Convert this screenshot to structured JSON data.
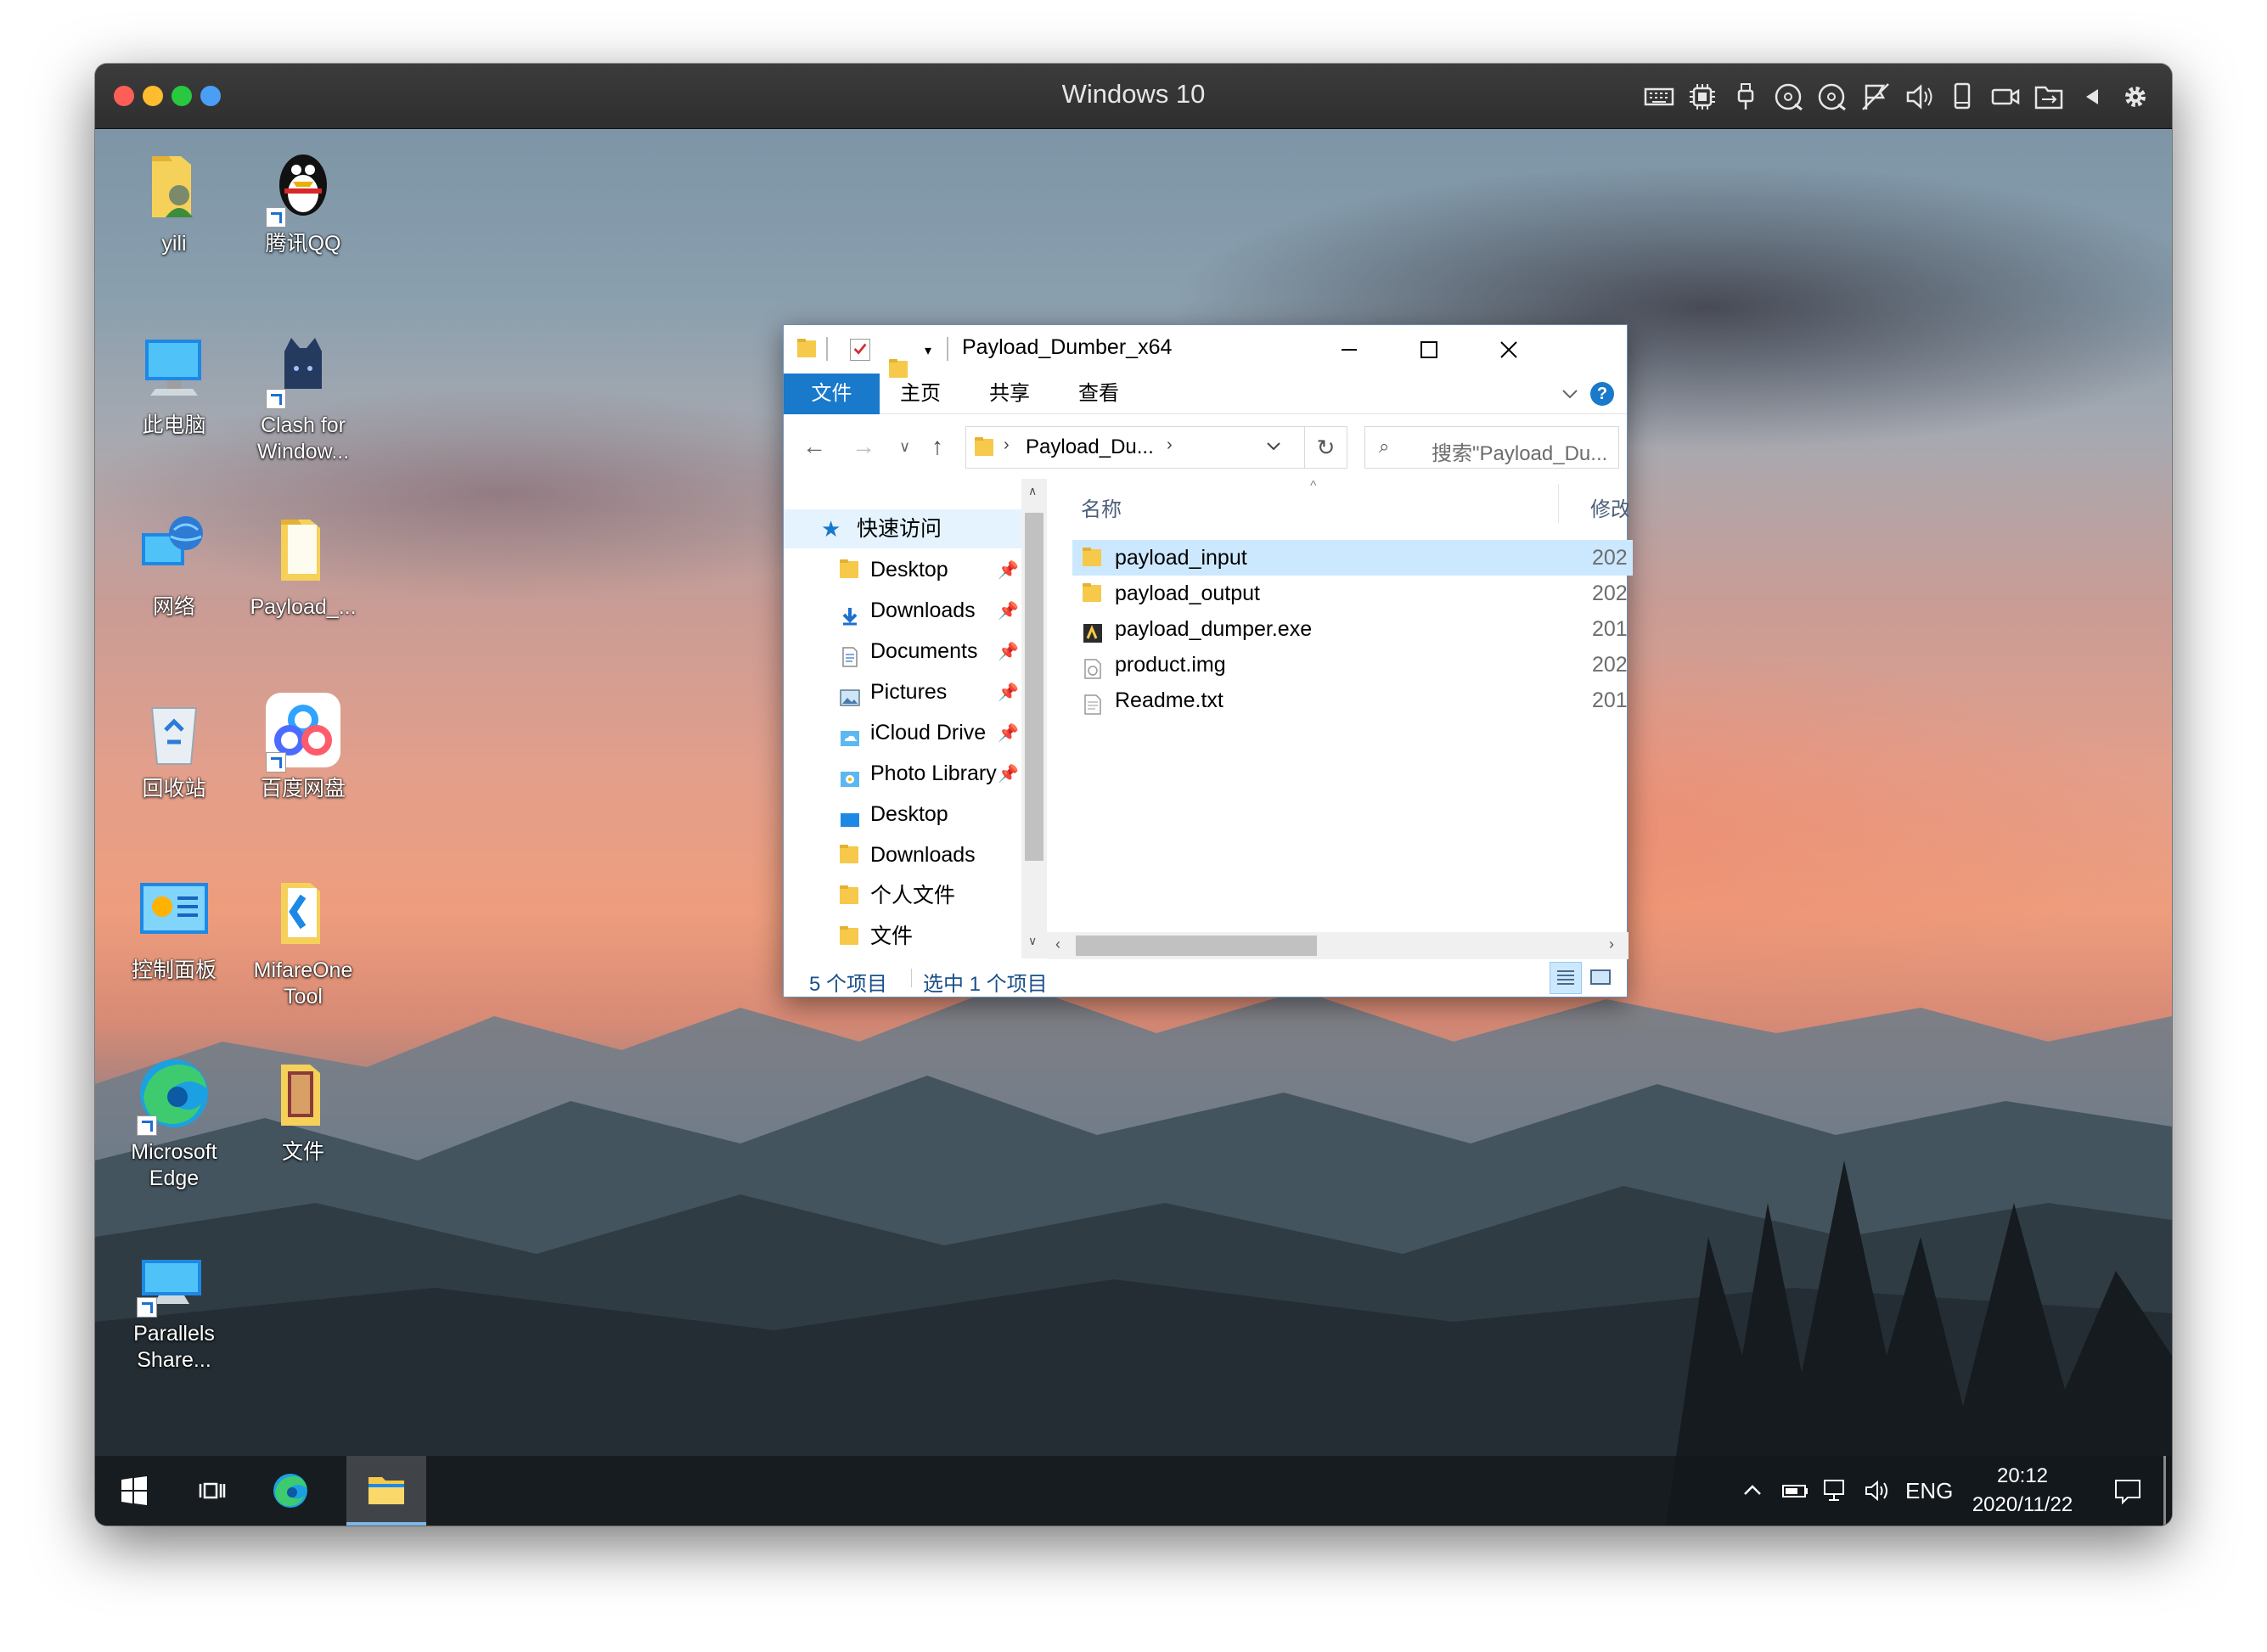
{
  "vm": {
    "title": "Windows 10",
    "traffic_lights": [
      "close",
      "minimize",
      "zoom",
      "extra"
    ],
    "toolbar_icons": [
      "keyboard-icon",
      "cpu-icon",
      "usb-icon",
      "cd-icon",
      "cd2-icon",
      "no-flag-icon",
      "sound-icon",
      "device-icon",
      "camera-icon",
      "shared-folder-icon",
      "collapse-icon",
      "gear-icon"
    ]
  },
  "desktop": {
    "icons": [
      {
        "label": "yili"
      },
      {
        "label": "腾讯QQ"
      },
      {
        "label": "此电脑"
      },
      {
        "label": "Clash for Window..."
      },
      {
        "label": "网络"
      },
      {
        "label": "Payload_..."
      },
      {
        "label": "回收站"
      },
      {
        "label": "百度网盘"
      },
      {
        "label": "控制面板"
      },
      {
        "label": "MifareOne Tool"
      },
      {
        "label": "Microsoft Edge"
      },
      {
        "label": "文件"
      },
      {
        "label": "Parallels Share..."
      }
    ]
  },
  "explorer": {
    "title": "Payload_Dumber_x64",
    "ribbon_tabs": [
      "文件",
      "主页",
      "共享",
      "查看"
    ],
    "address": "Payload_Du...",
    "search_placeholder": "搜索\"Payload_Du...",
    "nav": {
      "quick_access": "快速访问",
      "items": [
        {
          "label": "Desktop",
          "pinned": true
        },
        {
          "label": "Downloads",
          "pinned": true
        },
        {
          "label": "Documents",
          "pinned": true
        },
        {
          "label": "Pictures",
          "pinned": true
        },
        {
          "label": "iCloud Drive",
          "pinned": true
        },
        {
          "label": "Photo Library",
          "pinned": true
        },
        {
          "label": "Desktop",
          "pinned": false
        },
        {
          "label": "Downloads",
          "pinned": false
        },
        {
          "label": "个人文件",
          "pinned": false
        },
        {
          "label": "文件",
          "pinned": false
        }
      ]
    },
    "columns": {
      "name": "名称",
      "modified": "修改"
    },
    "files": [
      {
        "name": "payload_input",
        "date": "202",
        "selected": true
      },
      {
        "name": "payload_output",
        "date": "202",
        "selected": false
      },
      {
        "name": "payload_dumper.exe",
        "date": "201",
        "selected": false
      },
      {
        "name": "product.img",
        "date": "202",
        "selected": false
      },
      {
        "name": "Readme.txt",
        "date": "201",
        "selected": false
      }
    ],
    "status": {
      "count": "5 个项目",
      "selected": "选中 1 个项目"
    }
  },
  "taskbar": {
    "lang": "ENG",
    "time": "20:12",
    "date": "2020/11/22"
  }
}
